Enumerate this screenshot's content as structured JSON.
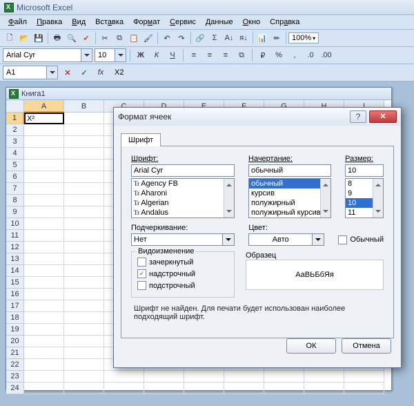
{
  "app": {
    "title": "Microsoft Excel"
  },
  "menu": {
    "file": "Файл",
    "edit": "Правка",
    "view": "Вид",
    "insert": "Вставка",
    "format": "Формат",
    "tools": "Сервис",
    "data": "Данные",
    "window": "Окно",
    "help": "Справка"
  },
  "toolbar": {
    "zoom": "100%"
  },
  "format": {
    "font": "Arial Cyr",
    "size": "10",
    "bold": "Ж",
    "italic": "К",
    "underline": "Ч"
  },
  "formula": {
    "cellref": "A1",
    "fx": "fx",
    "value": "X2"
  },
  "workbook": {
    "title": "Книга1",
    "cell_a1": "X²"
  },
  "cols": [
    "A",
    "B",
    "C",
    "D",
    "E",
    "F",
    "G",
    "H",
    "I"
  ],
  "rows": [
    "1",
    "2",
    "3",
    "4",
    "5",
    "6",
    "7",
    "8",
    "9",
    "10",
    "11",
    "12",
    "13",
    "14",
    "15",
    "16",
    "17",
    "18",
    "19",
    "20",
    "21",
    "22",
    "23",
    "24"
  ],
  "dialog": {
    "title": "Формат ячеек",
    "tab_font": "Шрифт",
    "font_label": "Шрифт:",
    "font_value": "Arial Cyr",
    "font_list": [
      "Agency FB",
      "Aharoni",
      "Algerian",
      "Andalus"
    ],
    "style_label": "Начертание:",
    "style_value": "обычный",
    "style_list": [
      "обычный",
      "курсив",
      "полужирный",
      "полужирный курсив"
    ],
    "size_label": "Размер:",
    "size_value": "10",
    "size_list": [
      "8",
      "9",
      "10",
      "11"
    ],
    "underline_label": "Подчеркивание:",
    "underline_value": "Нет",
    "color_label": "Цвет:",
    "color_value": "Авто",
    "normal_cb": "Обычный",
    "effects_label": "Видоизменение",
    "strike": "зачеркнутый",
    "super": "надстрочный",
    "sub": "подстрочный",
    "sample_label": "Образец",
    "sample_text": "АаВЬБбЯя",
    "warn": "Шрифт не найден. Для печати будет использован наиболее подходящий шрифт.",
    "ok": "ОК",
    "cancel": "Отмена"
  }
}
